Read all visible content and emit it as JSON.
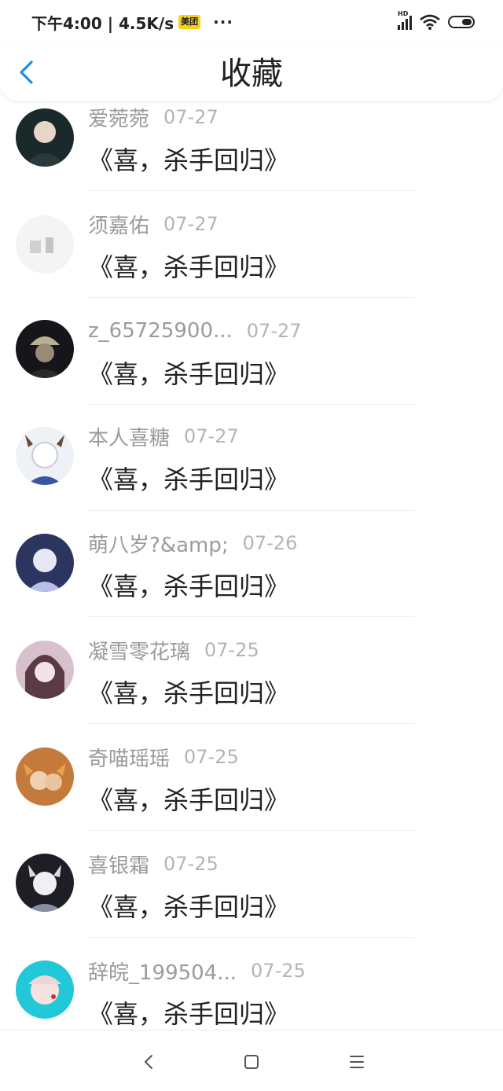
{
  "status_bar": {
    "time_speed": "下午4:00 | 4.5K/s",
    "app_badge": "美团",
    "more": "···",
    "hd": "HD"
  },
  "header": {
    "title": "收藏",
    "back_icon": "chevron-left-icon"
  },
  "items": [
    {
      "name": "爱菀菀",
      "date": "07-27",
      "book": "《喜，杀手回归》",
      "avatar_colors": [
        "#1a2a2a",
        "#3c5a58"
      ]
    },
    {
      "name": "须嘉佑",
      "date": "07-27",
      "book": "《喜，杀手回归》",
      "avatar_colors": [
        "#f4f4f4",
        "#d8d8d8"
      ]
    },
    {
      "name": "z_65725900...",
      "date": "07-27",
      "book": "《喜，杀手回归》",
      "avatar_colors": [
        "#15151a",
        "#5a5a48"
      ]
    },
    {
      "name": "本人喜糖",
      "date": "07-27",
      "book": "《喜，杀手回归》",
      "avatar_colors": [
        "#eef2f6",
        "#5a72a8"
      ]
    },
    {
      "name": "萌八岁?&amp;",
      "date": "07-26",
      "book": "《喜，杀手回归》",
      "avatar_colors": [
        "#2c3460",
        "#9aa6d8"
      ]
    },
    {
      "name": "凝雪零花璃",
      "date": "07-25",
      "book": "《喜，杀手回归》",
      "avatar_colors": [
        "#d8c0cc",
        "#6e4a58"
      ]
    },
    {
      "name": "奇喵瑶瑶",
      "date": "07-25",
      "book": "《喜，杀手回归》",
      "avatar_colors": [
        "#c47a3a",
        "#3a2030"
      ]
    },
    {
      "name": "喜银霜",
      "date": "07-25",
      "book": "《喜，杀手回归》",
      "avatar_colors": [
        "#1e1e24",
        "#b0b4c0"
      ]
    },
    {
      "name": "辞皖_199504...",
      "date": "07-25",
      "book": "《喜，杀手回归》",
      "avatar_colors": [
        "#22c8d8",
        "#f0d8d8"
      ]
    }
  ],
  "nav_bar": {
    "back_icon": "nav-back-icon",
    "home_icon": "nav-home-icon",
    "menu_icon": "nav-menu-icon"
  },
  "colors": {
    "accent": "#1a90e8",
    "name_text": "#9b9b9b",
    "date_text": "#b4b4b4",
    "body_text": "#222222"
  }
}
